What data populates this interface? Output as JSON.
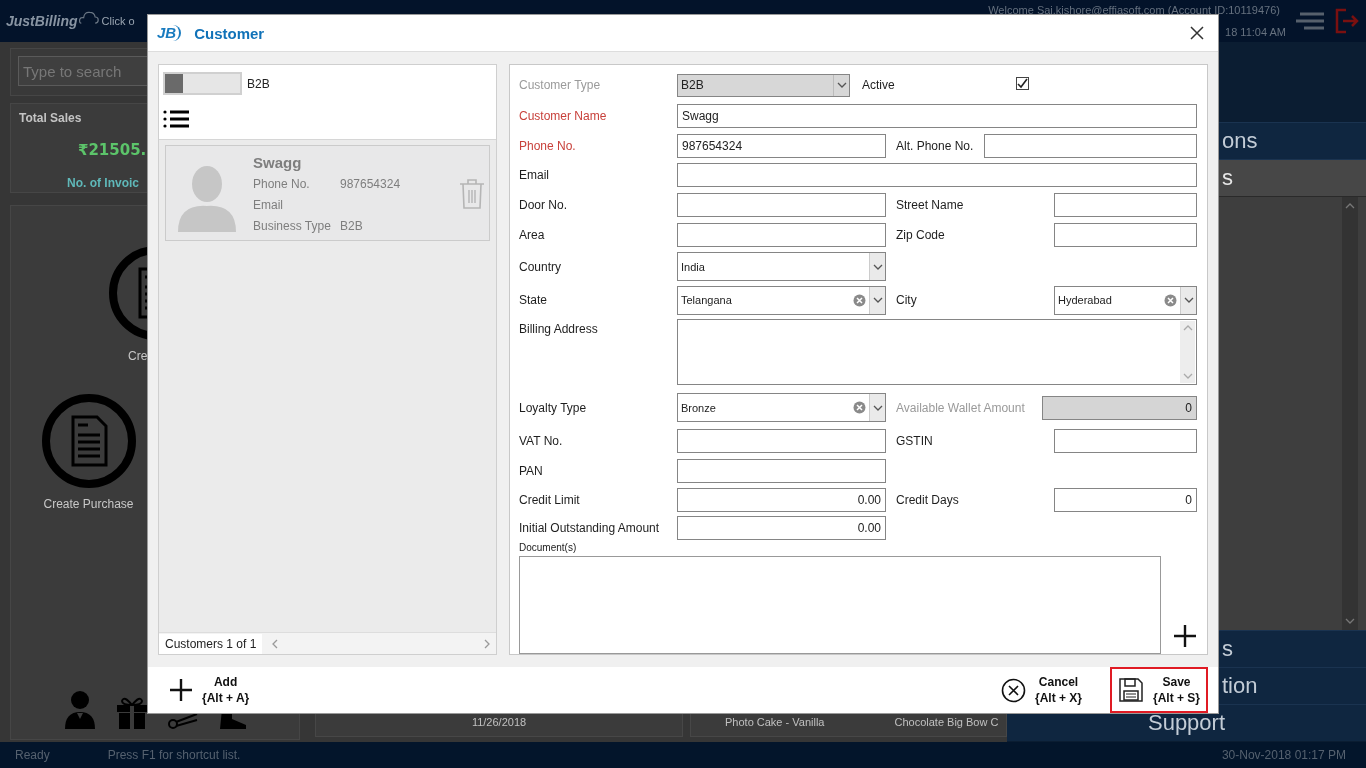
{
  "background": {
    "top_bar": {
      "logo": "JustBilling",
      "hint": "Click o",
      "welcome": "Welcome Sai.kishore@effiasoft.com (Account ID:10119476)",
      "time": "18 11:04 AM"
    },
    "search": {
      "placeholder": "Type to search"
    },
    "total_sales": {
      "title": "Total Sales",
      "amount": "₹21505.",
      "invoices": "No. of Invoic"
    },
    "actions": [
      {
        "label": "Cre"
      },
      {
        "label": "Create Purchase"
      }
    ],
    "recent_items": [
      "11/26/2018",
      "Photo Cake - Vanilla",
      "Chocolate Big Bow C"
    ],
    "menu": [
      {
        "label": "ons",
        "expanded": false
      },
      {
        "label": "s",
        "expanded": true
      },
      {
        "label": "s",
        "expanded": false
      },
      {
        "label": "tion",
        "expanded": false
      },
      {
        "label": "Support",
        "expanded": false
      }
    ],
    "status_bar": {
      "status": "Ready",
      "hint": "Press F1 for shortcut list.",
      "datetime": "30-Nov-2018 01:17 PM"
    }
  },
  "dialog": {
    "logo": "JB",
    "title": "Customer",
    "filter": {
      "toggle": {
        "label": "B2B",
        "on": false
      }
    },
    "customers": [
      {
        "name": "Swagg",
        "details": [
          {
            "label": "Phone No.",
            "value": "987654324"
          },
          {
            "label": "Email"
          },
          {
            "label": "Business Type",
            "value": "B2B"
          }
        ]
      }
    ],
    "record_count": "Customers 1 of 1",
    "form": {
      "rows": [
        [
          {
            "label": "Customer Type",
            "kind": "select",
            "value": "B2B",
            "required": false,
            "disabled": true
          },
          {
            "label": "Active",
            "kind": "checkbox",
            "checked": true,
            "required": false,
            "disabled": false
          }
        ],
        [
          {
            "label": "Customer Name",
            "kind": "text",
            "value": "Swagg",
            "required": true,
            "disabled": false
          }
        ],
        [
          {
            "label": "Phone No.",
            "kind": "text",
            "value": "987654324",
            "required": true,
            "disabled": false
          },
          {
            "label": "Alt. Phone No.",
            "kind": "text",
            "required": false,
            "disabled": false
          }
        ],
        [
          {
            "label": "Email",
            "kind": "text",
            "required": false,
            "disabled": false
          }
        ],
        [
          {
            "label": "Door No.",
            "kind": "text",
            "required": false,
            "disabled": false
          },
          {
            "label": "Street Name",
            "kind": "text",
            "required": false,
            "disabled": false
          }
        ],
        [
          {
            "label": "Area",
            "kind": "text",
            "required": false,
            "disabled": false
          },
          {
            "label": "Zip Code",
            "kind": "text",
            "required": false,
            "disabled": false
          }
        ],
        [
          {
            "label": "Country",
            "kind": "select",
            "value": "India",
            "required": false,
            "disabled": false
          }
        ],
        [
          {
            "label": "State",
            "kind": "combo",
            "value": "Telangana",
            "required": false,
            "disabled": false
          },
          {
            "label": "City",
            "kind": "combo",
            "value": "Hyderabad",
            "required": false,
            "disabled": false
          }
        ],
        [
          {
            "label": "Billing Address",
            "kind": "textarea",
            "required": false,
            "disabled": false
          }
        ],
        [
          {
            "label": "Loyalty Type",
            "kind": "combo",
            "value": "Bronze",
            "required": false,
            "disabled": false
          },
          {
            "label": "Available Wallet Amount",
            "kind": "number",
            "value": "0",
            "required": false,
            "disabled": true
          }
        ],
        [
          {
            "label": "VAT No.",
            "kind": "text",
            "required": false,
            "disabled": false
          },
          {
            "label": "GSTIN",
            "kind": "text",
            "required": false,
            "disabled": false
          }
        ],
        [
          {
            "label": "PAN",
            "kind": "text",
            "required": false,
            "disabled": false
          }
        ],
        [
          {
            "label": "Credit Limit",
            "kind": "number",
            "value": "0.00",
            "required": false,
            "disabled": false
          },
          {
            "label": "Credit Days",
            "kind": "number",
            "value": "0",
            "required": false,
            "disabled": false
          }
        ],
        [
          {
            "label": "Initial Outstanding Amount",
            "kind": "number",
            "value": "0.00",
            "required": false,
            "disabled": false
          }
        ]
      ],
      "documents": {
        "label": "Document(s)"
      }
    },
    "buttons": [
      {
        "kind": "add",
        "label": "Add",
        "shortcut": "{Alt + A}",
        "highlighted": false
      },
      {
        "kind": "cancel",
        "label": "Cancel",
        "shortcut": "{Alt + X}",
        "highlighted": false
      },
      {
        "kind": "save",
        "label": "Save",
        "shortcut": "{Alt + S}",
        "highlighted": true
      }
    ]
  }
}
